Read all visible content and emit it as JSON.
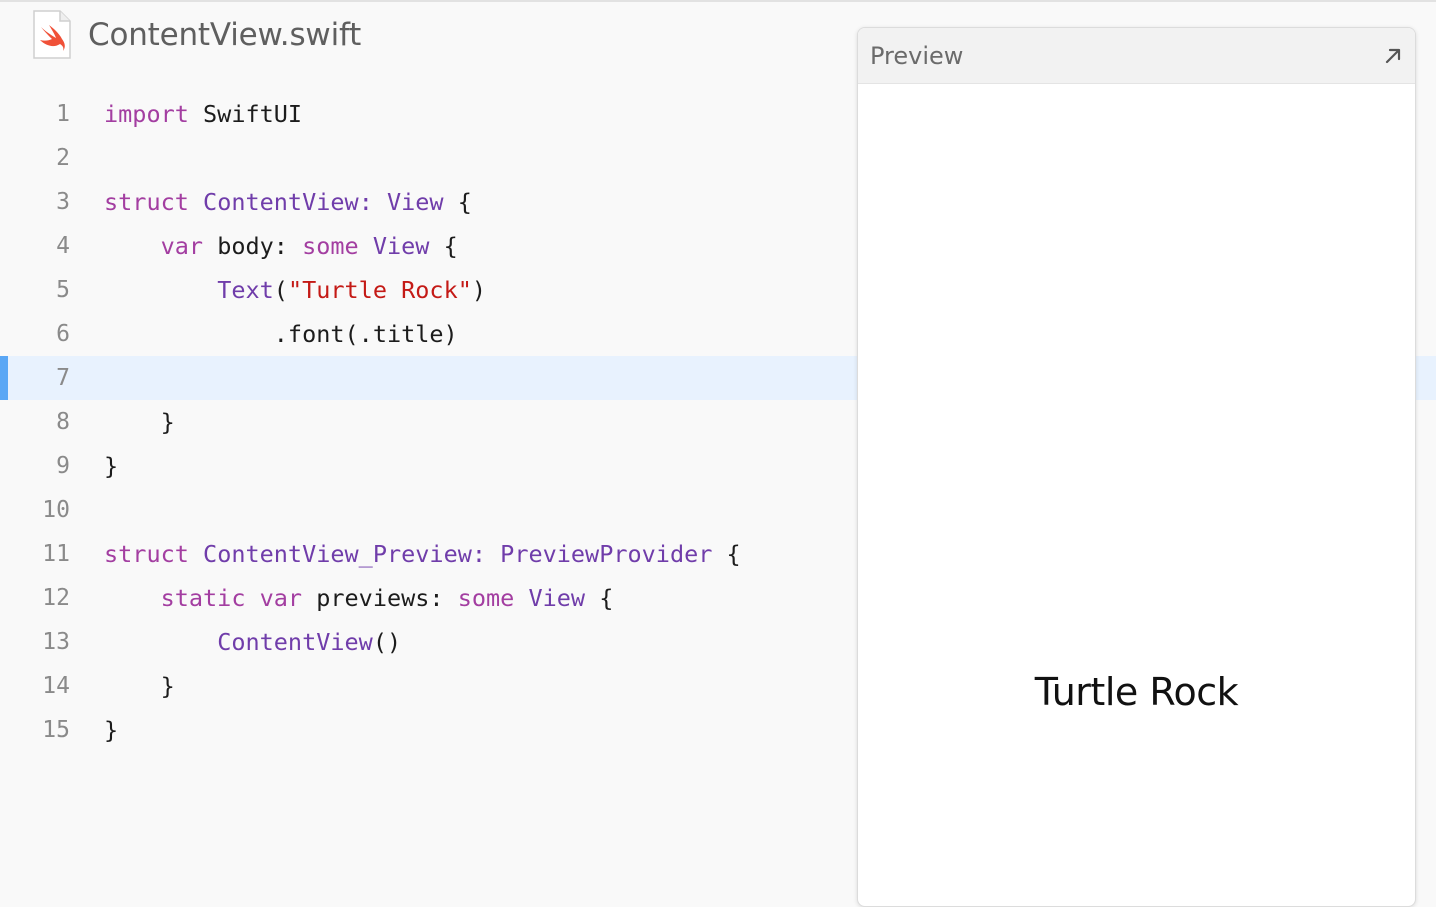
{
  "file": {
    "name": "ContentView.swift",
    "icon": "swift-file-icon"
  },
  "editor": {
    "current_line": 7,
    "lines": [
      {
        "number": "1",
        "tokens": [
          {
            "t": "import",
            "k": "kw"
          },
          {
            "t": " SwiftUI",
            "k": "plain"
          }
        ]
      },
      {
        "number": "2",
        "tokens": []
      },
      {
        "number": "3",
        "tokens": [
          {
            "t": "struct",
            "k": "kw"
          },
          {
            "t": " ",
            "k": "plain"
          },
          {
            "t": "ContentView",
            "k": "type"
          },
          {
            "t": ": ",
            "k": "type"
          },
          {
            "t": "View",
            "k": "type"
          },
          {
            "t": " {",
            "k": "plain"
          }
        ]
      },
      {
        "number": "4",
        "tokens": [
          {
            "t": "    ",
            "k": "plain"
          },
          {
            "t": "var",
            "k": "kw"
          },
          {
            "t": " body: ",
            "k": "plain"
          },
          {
            "t": "some",
            "k": "kw"
          },
          {
            "t": " ",
            "k": "plain"
          },
          {
            "t": "View",
            "k": "type"
          },
          {
            "t": " {",
            "k": "plain"
          }
        ]
      },
      {
        "number": "5",
        "tokens": [
          {
            "t": "        ",
            "k": "plain"
          },
          {
            "t": "Text",
            "k": "type"
          },
          {
            "t": "(",
            "k": "plain"
          },
          {
            "t": "\"Turtle Rock\"",
            "k": "str"
          },
          {
            "t": ")",
            "k": "plain"
          }
        ]
      },
      {
        "number": "6",
        "tokens": [
          {
            "t": "            .font(.title)",
            "k": "plain"
          }
        ]
      },
      {
        "number": "7",
        "tokens": []
      },
      {
        "number": "8",
        "tokens": [
          {
            "t": "    }",
            "k": "plain"
          }
        ]
      },
      {
        "number": "9",
        "tokens": [
          {
            "t": "}",
            "k": "plain"
          }
        ]
      },
      {
        "number": "10",
        "tokens": []
      },
      {
        "number": "11",
        "tokens": [
          {
            "t": "struct",
            "k": "kw"
          },
          {
            "t": " ",
            "k": "plain"
          },
          {
            "t": "ContentView_Preview",
            "k": "type"
          },
          {
            "t": ": ",
            "k": "type"
          },
          {
            "t": "PreviewProvider",
            "k": "type"
          },
          {
            "t": " {",
            "k": "plain"
          }
        ]
      },
      {
        "number": "12",
        "tokens": [
          {
            "t": "    ",
            "k": "plain"
          },
          {
            "t": "static",
            "k": "kw"
          },
          {
            "t": " ",
            "k": "plain"
          },
          {
            "t": "var",
            "k": "kw"
          },
          {
            "t": " previews: ",
            "k": "plain"
          },
          {
            "t": "some",
            "k": "kw"
          },
          {
            "t": " ",
            "k": "plain"
          },
          {
            "t": "View",
            "k": "type"
          },
          {
            "t": " {",
            "k": "plain"
          }
        ]
      },
      {
        "number": "13",
        "tokens": [
          {
            "t": "        ",
            "k": "plain"
          },
          {
            "t": "ContentView",
            "k": "type"
          },
          {
            "t": "()",
            "k": "plain"
          }
        ]
      },
      {
        "number": "14",
        "tokens": [
          {
            "t": "    }",
            "k": "plain"
          }
        ]
      },
      {
        "number": "15",
        "tokens": [
          {
            "t": "}",
            "k": "plain"
          }
        ]
      }
    ]
  },
  "preview": {
    "title": "Preview",
    "expand_icon": "expand-arrow-icon",
    "rendered_text": "Turtle Rock"
  },
  "colors": {
    "keyword": "#a33ea1",
    "type": "#703daa",
    "string": "#c41a16",
    "current_line_bg": "#e8f2fe",
    "current_line_marker": "#5aa7f5"
  }
}
